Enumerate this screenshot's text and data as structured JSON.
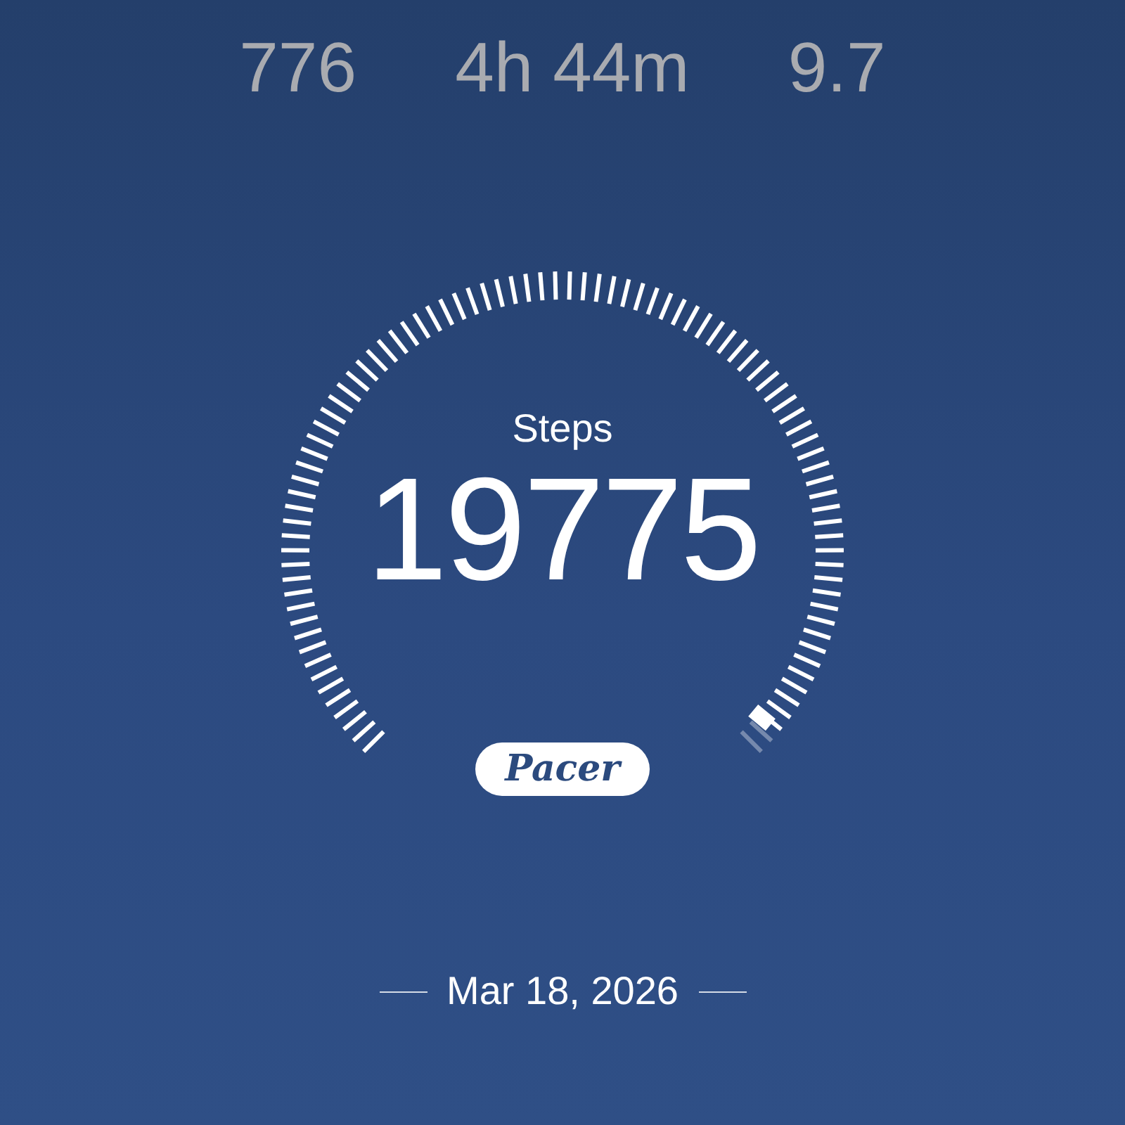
{
  "stats": [
    {
      "value": "776"
    },
    {
      "value": "4h 44m"
    },
    {
      "value": "9.7"
    }
  ],
  "gauge": {
    "label": "Steps",
    "value": "19775"
  },
  "brand": "Pacer",
  "date": "Mar 18, 2026"
}
